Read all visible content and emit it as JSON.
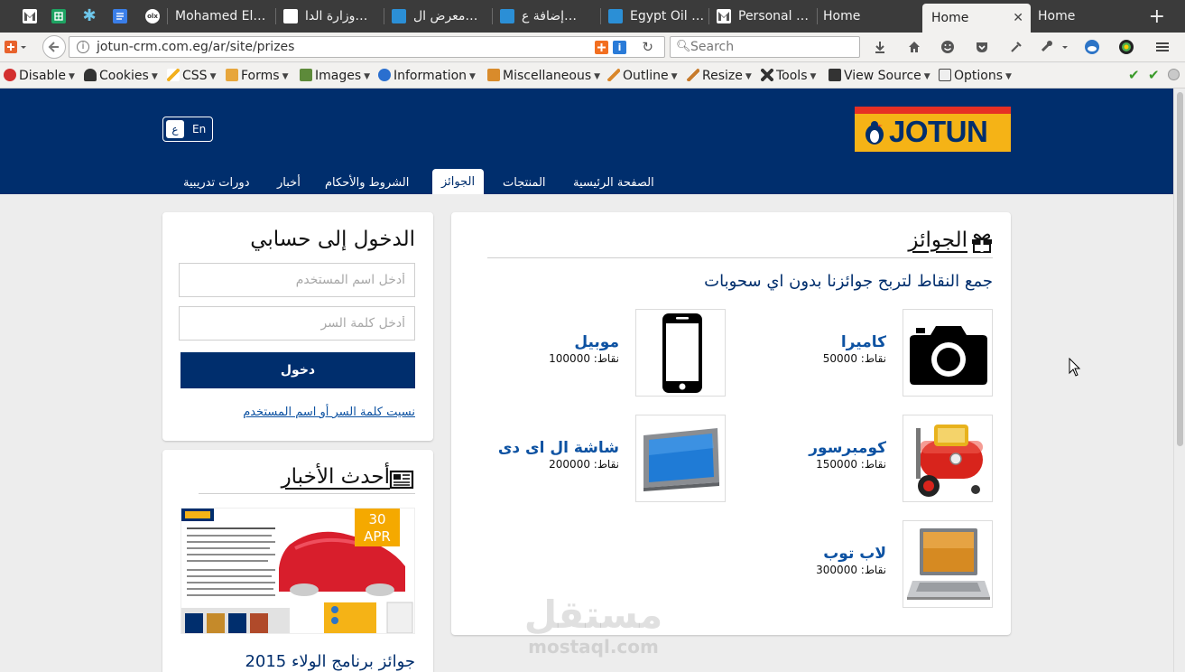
{
  "browser": {
    "tabs": [
      {
        "label": "",
        "icon": "gmail-icon",
        "pinned": true
      },
      {
        "label": "",
        "icon": "sheets-icon",
        "pinned": true
      },
      {
        "label": "",
        "icon": "asterisk-icon",
        "pinned": true
      },
      {
        "label": "",
        "icon": "docs-icon",
        "pinned": true
      },
      {
        "label": "",
        "icon": "olx-icon",
        "pinned": true
      },
      {
        "label": "Mohamed El…",
        "icon": "none"
      },
      {
        "label": "وزارة الدا…",
        "icon": "document-icon"
      },
      {
        "label": "معرض ال…",
        "icon": "app-icon"
      },
      {
        "label": "إضافة ع…",
        "icon": "app-icon"
      },
      {
        "label": "Egypt Oil …",
        "icon": "app-icon"
      },
      {
        "label": "Personal …",
        "icon": "gmail-icon"
      },
      {
        "label": "Home",
        "icon": "none"
      },
      {
        "label": "Home",
        "icon": "none",
        "active": true
      },
      {
        "label": "Home",
        "icon": "none"
      }
    ],
    "url": "jotun-crm.com.eg/ar/site/prizes",
    "search_placeholder": "Search",
    "devtools": [
      {
        "label": "Disable",
        "icon": "disable-icon"
      },
      {
        "label": "Cookies",
        "icon": "cookies-icon"
      },
      {
        "label": "CSS",
        "icon": "css-icon"
      },
      {
        "label": "Forms",
        "icon": "forms-icon"
      },
      {
        "label": "Images",
        "icon": "images-icon"
      },
      {
        "label": "Information",
        "icon": "information-icon"
      },
      {
        "label": "Miscellaneous",
        "icon": "miscellaneous-icon"
      },
      {
        "label": "Outline",
        "icon": "outline-icon"
      },
      {
        "label": "Resize",
        "icon": "resize-icon"
      },
      {
        "label": "Tools",
        "icon": "tools-icon"
      },
      {
        "label": "View Source",
        "icon": "view-source-icon"
      },
      {
        "label": "Options",
        "icon": "options-icon"
      }
    ]
  },
  "site": {
    "brand": "JOTUN",
    "lang": {
      "ar": "ع",
      "en": "En"
    },
    "nav": [
      {
        "label": "الصفحة الرئيسية"
      },
      {
        "label": "المنتجات"
      },
      {
        "label": "الجوائز",
        "active": true
      },
      {
        "label": "الشروط والأحكام"
      },
      {
        "label": "أخبار"
      },
      {
        "label": "دورات تدريبية"
      }
    ],
    "colors": {
      "header": "#002e6d",
      "brand_yellow": "#f5b316",
      "brand_red": "#e63024",
      "link": "#0d52a2",
      "badge": "#f5a900"
    }
  },
  "prizes": {
    "title": "الجوائز",
    "intro": "جمع النقاط لتربح جوائزنا بدون اي سحوبات",
    "items": [
      {
        "name": "كاميرا",
        "points": "نقاط: 50000",
        "icon": "camera-icon"
      },
      {
        "name": "موبيل",
        "points": "نقاط: 100000",
        "icon": "mobile-icon"
      },
      {
        "name": "كومبرسور",
        "points": "نقاط: 150000",
        "icon": "compressor-icon"
      },
      {
        "name": "شاشة ال اى دى",
        "points": "نقاط: 200000",
        "icon": "lcd-screen-icon"
      },
      {
        "name": "لاب توب",
        "points": "نقاط: 300000",
        "icon": "laptop-icon"
      }
    ]
  },
  "login": {
    "title": "الدخول إلى حسابي",
    "username_placeholder": "أدخل اسم المستخدم",
    "password_placeholder": "أدخل كلمة السر",
    "submit": "دخول",
    "forgot": "نسيت كلمة السر أو اسم المستخدم"
  },
  "news": {
    "title": "أحدث الأخبار",
    "badge_day": "30",
    "badge_month": "APR",
    "headline": "جوائز برنامج الولاء 2015"
  },
  "watermark": {
    "line1": "مستقل",
    "line2": "mostaql.com"
  }
}
